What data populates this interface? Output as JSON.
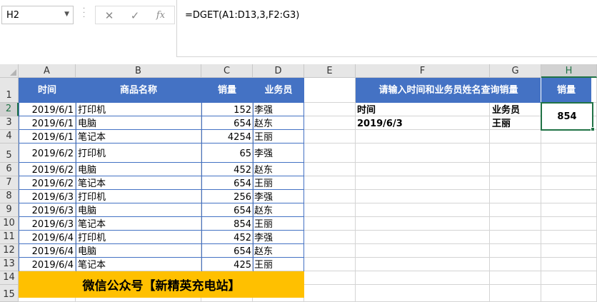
{
  "name_box": "H2",
  "formula_buttons": {
    "cancel": "✕",
    "confirm": "✓",
    "function": "fx"
  },
  "formula": "=DGET(A1:D13,3,F2:G3)",
  "columns": [
    "A",
    "B",
    "C",
    "D",
    "E",
    "F",
    "G",
    "H"
  ],
  "rows": [
    "1",
    "2",
    "3",
    "4",
    "5",
    "6",
    "7",
    "8",
    "9",
    "10",
    "11",
    "12",
    "13",
    "14",
    "15"
  ],
  "headers": {
    "time": "时间",
    "product": "商品名称",
    "sales": "销量",
    "salesperson": "业务员"
  },
  "data_rows": [
    [
      "2019/6/1",
      "打印机",
      "152",
      "李强"
    ],
    [
      "2019/6/1",
      "电脑",
      "654",
      "赵东"
    ],
    [
      "2019/6/1",
      "笔记本",
      "4254",
      "王丽"
    ],
    [
      "2019/6/2",
      "打印机",
      "65",
      "李强"
    ],
    [
      "2019/6/2",
      "电脑",
      "452",
      "赵东"
    ],
    [
      "2019/6/2",
      "笔记本",
      "654",
      "王丽"
    ],
    [
      "2019/6/3",
      "打印机",
      "256",
      "李强"
    ],
    [
      "2019/6/3",
      "电脑",
      "654",
      "赵东"
    ],
    [
      "2019/6/3",
      "笔记本",
      "854",
      "王丽"
    ],
    [
      "2019/6/4",
      "打印机",
      "452",
      "李强"
    ],
    [
      "2019/6/4",
      "电脑",
      "654",
      "赵东"
    ],
    [
      "2019/6/4",
      "笔记本",
      "425",
      "王丽"
    ]
  ],
  "banner": "微信公众号【新精英充电站】",
  "query": {
    "title": "请输入时间和业务员姓名查询销量",
    "result_header": "销量",
    "criteria_headers": [
      "时间",
      "业务员"
    ],
    "criteria_values": [
      "2019/6/3",
      "王丽"
    ],
    "result": "854"
  },
  "colors": {
    "header_blue": "#4472c4",
    "banner_yellow": "#ffc000",
    "selection_green": "#217346"
  }
}
